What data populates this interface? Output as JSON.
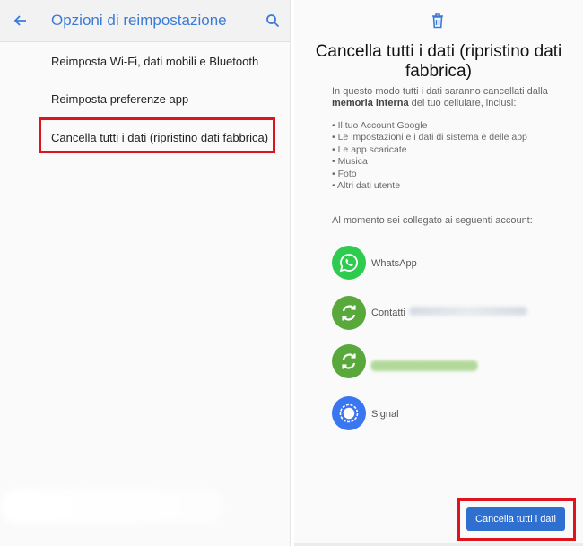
{
  "left_screen": {
    "title": "Opzioni di reimpostazione",
    "back_icon": "arrow-back-icon",
    "search_icon": "search-icon",
    "items": [
      {
        "label": "Reimposta Wi-Fi, dati mobili e Bluetooth"
      },
      {
        "label": "Reimposta preferenze app"
      },
      {
        "label": "Cancella tutti i dati (ripristino dati fabbrica)",
        "highlighted": true
      }
    ]
  },
  "right_screen": {
    "title": "Cancella tutti i dati (ripristino dati fabbrica)",
    "intro_before": "In questo modo tutti i dati saranno cancellati dalla ",
    "intro_bold": "memoria interna",
    "intro_after": " del tuo cellulare, inclusi:",
    "bullets": [
      "• Il tuo Account Google",
      "• Le impostazioni e i dati di sistema e delle app",
      "• Le app scaricate",
      "• Musica",
      "• Foto",
      "• Altri dati utente"
    ],
    "accounts_intro": "Al momento sei collegato ai seguenti account:",
    "accounts": [
      {
        "label": "WhatsApp",
        "icon": "whatsapp-icon",
        "color": "#2fcb4f"
      },
      {
        "label": "Contatti",
        "icon": "sync-icon",
        "color": "#59a83c"
      },
      {
        "label": "",
        "icon": "sync-icon",
        "color": "#59a83c"
      },
      {
        "label": "Signal",
        "icon": "signal-icon",
        "color": "#3a76f0"
      }
    ],
    "confirm_button": "Cancella tutti i dati"
  },
  "colors": {
    "accent": "#3b7bd6",
    "highlight_border": "#e0141d",
    "button": "#2f6fd0"
  }
}
